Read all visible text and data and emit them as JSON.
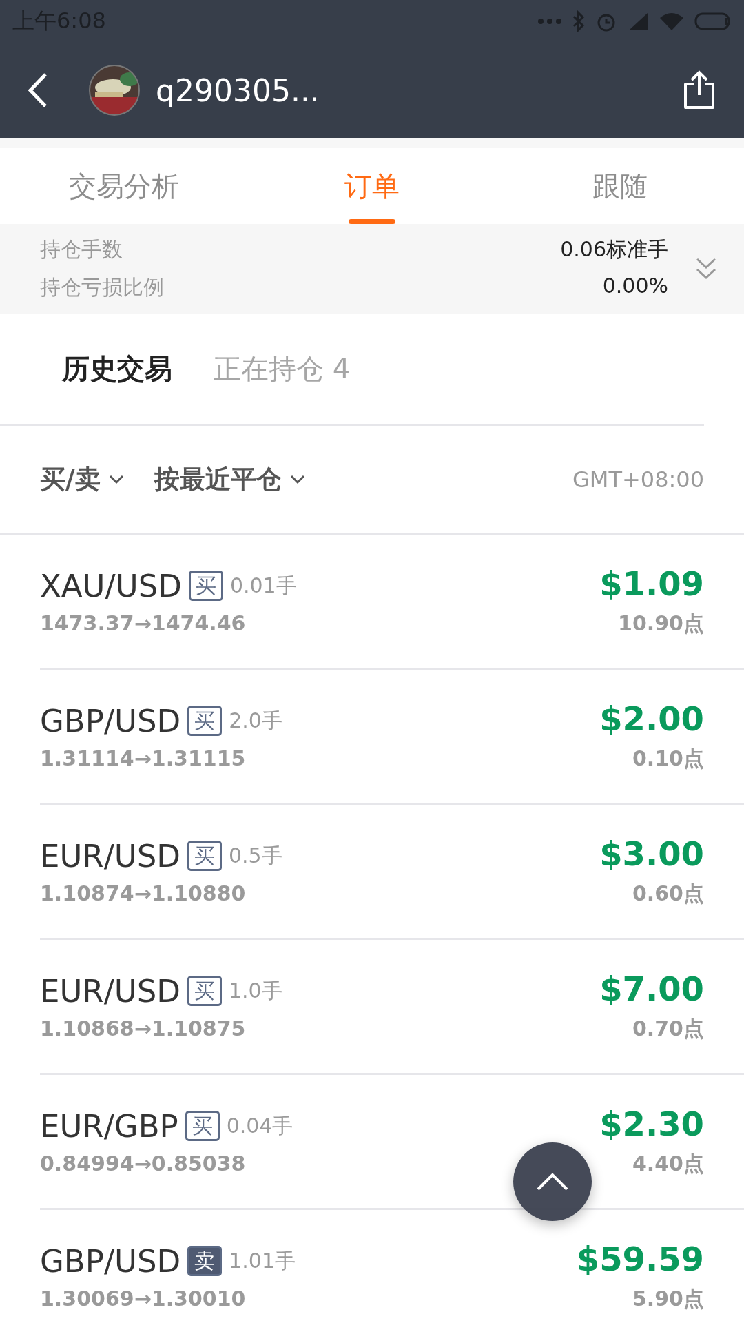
{
  "status_bar": {
    "time": "上午6:08"
  },
  "header": {
    "title": "q290305..."
  },
  "tabs": [
    {
      "label": "交易分析",
      "selected": false
    },
    {
      "label": "订单",
      "selected": true
    },
    {
      "label": "跟随",
      "selected": false
    }
  ],
  "summary": {
    "expanded": false,
    "rows": [
      {
        "label": "持仓手数",
        "value": "0.06标准手"
      },
      {
        "label": "持仓亏损比例",
        "value": "0.00%"
      }
    ]
  },
  "sub_tabs": [
    {
      "label": "历史交易",
      "selected": true
    },
    {
      "label": "正在持仓 4",
      "selected": false
    }
  ],
  "filters": [
    {
      "label": "买/卖"
    },
    {
      "label": "按最近平仓"
    }
  ],
  "timezone": "GMT+08:00",
  "orders": [
    {
      "symbol": "XAU/USD",
      "kind": "buy",
      "side": "买",
      "lots": "0.01手",
      "prices": "1473.37→1474.46",
      "profit": "$1.09",
      "points": "10.90点"
    },
    {
      "symbol": "GBP/USD",
      "kind": "buy",
      "side": "买",
      "lots": "2.0手",
      "prices": "1.31114→1.31115",
      "profit": "$2.00",
      "points": "0.10点"
    },
    {
      "symbol": "EUR/USD",
      "kind": "buy",
      "side": "买",
      "lots": "0.5手",
      "prices": "1.10874→1.10880",
      "profit": "$3.00",
      "points": "0.60点"
    },
    {
      "symbol": "EUR/USD",
      "kind": "buy",
      "side": "买",
      "lots": "1.0手",
      "prices": "1.10868→1.10875",
      "profit": "$7.00",
      "points": "0.70点"
    },
    {
      "symbol": "EUR/GBP",
      "kind": "buy",
      "side": "买",
      "lots": "0.04手",
      "prices": "0.84994→0.85038",
      "profit": "$2.30",
      "points": "4.40点"
    },
    {
      "symbol": "GBP/USD",
      "kind": "sell",
      "side": "卖",
      "lots": "1.01手",
      "prices": "1.30069→1.30010",
      "profit": "$59.59",
      "points": "5.90点"
    }
  ]
}
